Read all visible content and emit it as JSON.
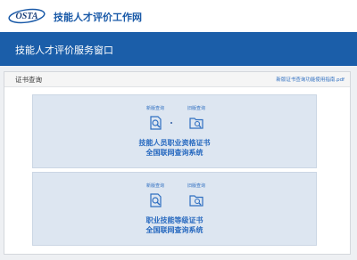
{
  "header": {
    "logo_text": "OSTA",
    "site_title": "技能人才评价工作网"
  },
  "banner": {
    "title": "技能人才评价服务窗口"
  },
  "panel": {
    "title": "证书查询",
    "pdf_link": "新版证书查询功能使用指南.pdf"
  },
  "cards": [
    {
      "new_label": "新版查询",
      "old_label": "旧版查询",
      "title_line1": "技能人员职业资格证书",
      "title_line2": "全国联网查询系统"
    },
    {
      "new_label": "新版查询",
      "old_label": "旧版查询",
      "title_line1": "职业技能等级证书",
      "title_line2": "全国联网查询系统"
    }
  ],
  "icons": {
    "new_query": "magnifier-document-icon",
    "old_query": "folder-search-icon"
  },
  "colors": {
    "brand_blue": "#1b5ea9",
    "link_blue": "#2f6fc1",
    "card_bg": "#dde6f1"
  }
}
